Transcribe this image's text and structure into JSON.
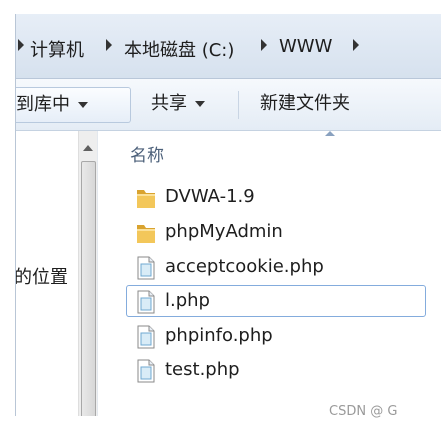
{
  "breadcrumb": [
    {
      "label": "计算机"
    },
    {
      "label": "本地磁盘 (C:)"
    },
    {
      "label": "WWW"
    }
  ],
  "toolbar": {
    "include_label": "到库中",
    "share_label": "共享",
    "new_folder_label": "新建文件夹"
  },
  "navpane": {
    "partial_label": "的位置"
  },
  "filelist": {
    "column_name": "名称",
    "items": [
      {
        "name": "DVWA-1.9",
        "type": "folder-icon"
      },
      {
        "name": "phpMyAdmin",
        "type": "folder-icon"
      },
      {
        "name": "acceptcookie.php",
        "type": "file-icon"
      },
      {
        "name": "l.php",
        "type": "file-icon",
        "selected": true
      },
      {
        "name": "phpinfo.php",
        "type": "file-icon"
      },
      {
        "name": "test.php",
        "type": "file-icon"
      }
    ]
  },
  "watermark": "CSDN @ G",
  "colors": {
    "folder": "#e8b84a",
    "selection_border": "#84acdd",
    "header_text": "#4c607a"
  }
}
